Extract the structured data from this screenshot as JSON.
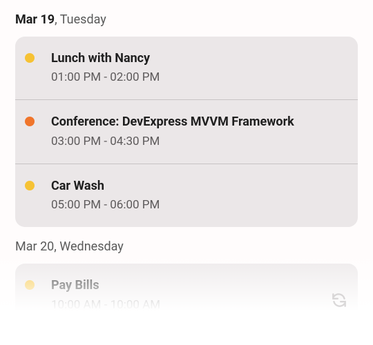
{
  "day1": {
    "dateBold": "Mar 19",
    "dateRest": ", Tuesday",
    "events": [
      {
        "title": "Lunch with Nancy",
        "time": "01:00 PM - 02:00 PM",
        "color": "#f6c234"
      },
      {
        "title": "Conference: DevExpress MVVM Framework",
        "time": "03:00 PM - 04:30 PM",
        "color": "#f0752b"
      },
      {
        "title": "Car Wash",
        "time": "05:00 PM - 06:00 PM",
        "color": "#f6c234"
      }
    ]
  },
  "day2": {
    "dateFull": "Mar 20, Wednesday",
    "events": [
      {
        "title": "Pay Bills",
        "time": "10:00 AM - 10:00 AM",
        "color": "#f6c234"
      }
    ]
  },
  "icons": {
    "refresh": "refresh-icon"
  }
}
